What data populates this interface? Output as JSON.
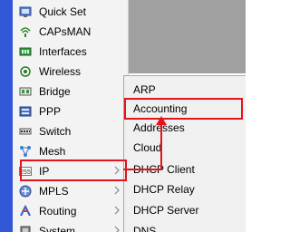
{
  "sidebar": {
    "items": [
      {
        "label": "Quick Set",
        "icon": "quick-set-icon",
        "has_submenu": false
      },
      {
        "label": "CAPsMAN",
        "icon": "capsman-icon",
        "has_submenu": false
      },
      {
        "label": "Interfaces",
        "icon": "interfaces-icon",
        "has_submenu": false
      },
      {
        "label": "Wireless",
        "icon": "wireless-icon",
        "has_submenu": false
      },
      {
        "label": "Bridge",
        "icon": "bridge-icon",
        "has_submenu": false
      },
      {
        "label": "PPP",
        "icon": "ppp-icon",
        "has_submenu": false
      },
      {
        "label": "Switch",
        "icon": "switch-icon",
        "has_submenu": false
      },
      {
        "label": "Mesh",
        "icon": "mesh-icon",
        "has_submenu": false
      },
      {
        "label": "IP",
        "icon": "ip-icon",
        "has_submenu": true
      },
      {
        "label": "MPLS",
        "icon": "mpls-icon",
        "has_submenu": true
      },
      {
        "label": "Routing",
        "icon": "routing-icon",
        "has_submenu": true
      },
      {
        "label": "System",
        "icon": "system-icon",
        "has_submenu": true
      }
    ],
    "ip_icon_text": "255"
  },
  "submenu": {
    "items": [
      {
        "label": "ARP"
      },
      {
        "label": "Accounting"
      },
      {
        "label": "Addresses"
      },
      {
        "label": "Cloud"
      },
      {
        "label": "DHCP Client"
      },
      {
        "label": "DHCP Relay"
      },
      {
        "label": "DHCP Server"
      },
      {
        "label": "DNS"
      }
    ]
  },
  "colors": {
    "highlight": "#e3141b",
    "accent_bar": "#2f57d6",
    "menu_bg": "#f0f0f0",
    "sidebar_bg": "#f3f3f3"
  }
}
